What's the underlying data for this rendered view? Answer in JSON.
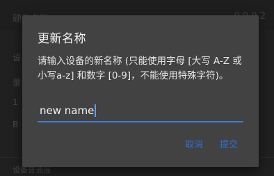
{
  "background": {
    "top_left": "硬件名称",
    "top_right": "9.9.9.2",
    "rows": [
      "设",
      "录",
      "1",
      "B"
    ],
    "bottom_text": "设备普通报"
  },
  "dialog": {
    "title": "更新名称",
    "message": "请输入设备的新名称 (只能使用字母 [大写 A-Z 或 小写a-z] 和数字 [0-9]，不能使用特殊字符)。",
    "input": {
      "value": "new name"
    },
    "cancel_label": "取消",
    "submit_label": "提交"
  }
}
